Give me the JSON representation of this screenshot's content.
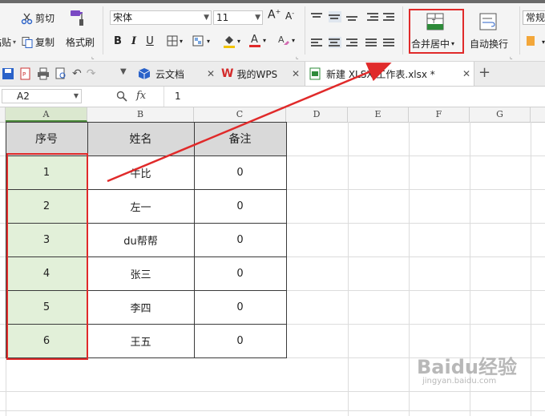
{
  "ribbon": {
    "cut_label": "剪切",
    "copy_label": "复制",
    "paste_label": "粘贴",
    "format_painter_label": "格式刷",
    "font_name": "宋体",
    "font_size": "11",
    "bold": "B",
    "italic": "I",
    "underline": "U",
    "merge_center_label": "合并居中",
    "wrap_text_label": "自动换行",
    "number_format": "常规"
  },
  "quickbar": {
    "tabs": [
      {
        "label": "云文档"
      },
      {
        "label": "我的WPS"
      },
      {
        "label": "新建 XLSX 工作表.xlsx *"
      }
    ]
  },
  "formula_bar": {
    "cell_ref": "A2",
    "fx": "fx",
    "value": "1"
  },
  "columns": [
    "A",
    "B",
    "C",
    "D",
    "E",
    "F",
    "G"
  ],
  "table": {
    "headers": [
      "序号",
      "姓名",
      "备注"
    ],
    "rows": [
      [
        "1",
        "牛比",
        "0"
      ],
      [
        "2",
        "左一",
        "0"
      ],
      [
        "3",
        "du帮帮",
        "0"
      ],
      [
        "4",
        "张三",
        "0"
      ],
      [
        "5",
        "李四",
        "0"
      ],
      [
        "6",
        "王五",
        "0"
      ]
    ]
  },
  "watermark": {
    "text": "Baidu经验",
    "sub": "jingyan.baidu.com"
  },
  "colors": {
    "accent_red": "#e02a2a",
    "selection_green": "#e2f0d9",
    "header_gray": "#d9d9d9"
  }
}
